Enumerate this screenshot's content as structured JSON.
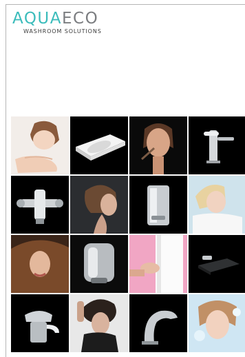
{
  "brand": {
    "name_part1": "AQUA",
    "name_part2": "ECO",
    "tagline": "WASHROOM SOLUTIONS",
    "color_primary": "#3bbcbb",
    "color_secondary": "#7b7d80"
  },
  "gallery": {
    "tiles": [
      {
        "icon": "woman-washing-face-photo",
        "background": "#f1ece8"
      },
      {
        "icon": "washbasin-photo",
        "background": "#000000"
      },
      {
        "icon": "woman-applying-makeup-photo",
        "background": "#0a0a0a"
      },
      {
        "icon": "lever-tap-photo",
        "background": "#000000"
      },
      {
        "icon": "thermostatic-valve-photo",
        "background": "#000000"
      },
      {
        "icon": "woman-hair-profile-photo",
        "background": "#2a2c2e"
      },
      {
        "icon": "soap-dispenser-photo",
        "background": "#000000"
      },
      {
        "icon": "woman-with-towel-photo",
        "background": "#cfe3ec"
      },
      {
        "icon": "woman-flowing-hair-photo",
        "background": "#3a2418"
      },
      {
        "icon": "hand-dryer-photo",
        "background": "#0b0b0b"
      },
      {
        "icon": "hands-towel-photo",
        "background": "#f1a6c4"
      },
      {
        "icon": "shower-seat-photo",
        "background": "#000000"
      },
      {
        "icon": "mixer-tap-photo",
        "background": "#000000"
      },
      {
        "icon": "woman-styled-hair-photo",
        "background": "#e9e9e9"
      },
      {
        "icon": "sensor-tap-photo",
        "background": "#000000"
      },
      {
        "icon": "woman-water-splash-photo",
        "background": "#cfe6f3"
      }
    ]
  }
}
